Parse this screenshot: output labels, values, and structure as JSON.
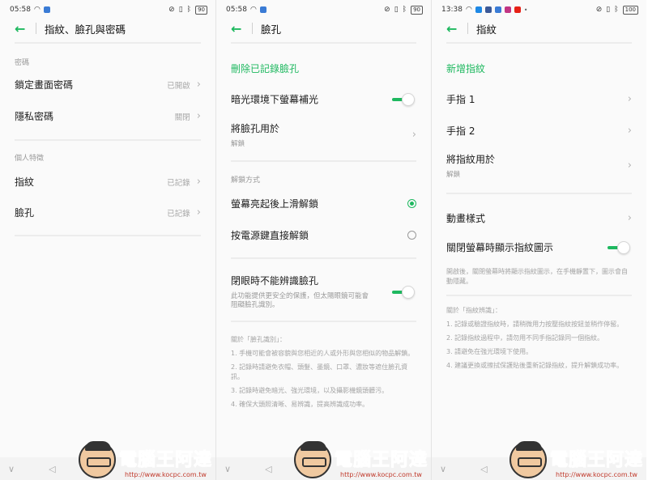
{
  "panel1": {
    "status": {
      "time": "05:58",
      "battery": "90"
    },
    "title": "指紋、臉孔與密碼",
    "sections": [
      {
        "label": "密碼",
        "items": [
          {
            "label": "鎖定畫面密碼",
            "value": "已開啟"
          },
          {
            "label": "隱私密碼",
            "value": "關閉"
          }
        ]
      },
      {
        "label": "個人特徵",
        "items": [
          {
            "label": "指紋",
            "value": "已記錄"
          },
          {
            "label": "臉孔",
            "value": "已記錄"
          }
        ]
      }
    ]
  },
  "panel2": {
    "status": {
      "time": "05:58",
      "battery": "90"
    },
    "title": "臉孔",
    "delete_label": "刪除已記錄臉孔",
    "dark_fill": {
      "label": "暗光環境下螢幕補光",
      "on": true
    },
    "use_face": {
      "label": "將臉孔用於",
      "sub": "解鎖"
    },
    "unlock_section": "解鎖方式",
    "unlock_options": [
      {
        "label": "螢幕亮起後上滑解鎖",
        "selected": true
      },
      {
        "label": "按電源鍵直接解鎖",
        "selected": false
      }
    ],
    "eyes_closed": {
      "label": "閉眼時不能辨識臉孔",
      "sub1": "此功能提供更安全的保護，但太陽眼鏡可能會",
      "sub2": "阻礙臉孔識別。",
      "on": true
    },
    "about_title": "關於「臉孔識別」：",
    "notes": [
      "1. 手機可能會被容貌與您相近的人或外形與您相似的物品解鎖。",
      "2. 記錄時請避免衣帽、頭髮、墨鏡、口罩、濃妝等遮住臉孔資訊。",
      "3. 記錄時避免暗光、強光環境，以及攝影機鏡頭髒污。",
      "4. 確保大頭照清晰、易辨識，提高辨識成功率。"
    ]
  },
  "panel3": {
    "status": {
      "time": "13:38",
      "battery": "100"
    },
    "title": "指紋",
    "add_label": "新增指紋",
    "fingers": [
      "手指 1",
      "手指 2"
    ],
    "use_fp": {
      "label": "將指紋用於",
      "sub": "解鎖"
    },
    "anim": {
      "label": "動畫樣式"
    },
    "show_icon": {
      "label": "關閉螢幕時顯示指紋圖示",
      "on": true
    },
    "show_icon_note": "開啟後，關閉螢幕時將顯示指紋圖示，在手機靜置下，圖示會自動隱藏。",
    "about_title": "關於「指紋辨識」：",
    "notes": [
      "1. 記錄或驗證指紋時，請稍微用力按壓指紋按鈕並稍作停留。",
      "2. 記錄指紋過程中，請勿用不同手指記錄同一個指紋。",
      "3. 請避免在強光環境下使用。",
      "4. 建議更換或擦拭保護貼後重新記錄指紋，提升解鎖成功率。"
    ]
  },
  "watermark": {
    "brand": "電腦王阿達",
    "url": "http://www.kocpc.com.tw"
  },
  "colors": {
    "accent": "#1eb85f"
  }
}
